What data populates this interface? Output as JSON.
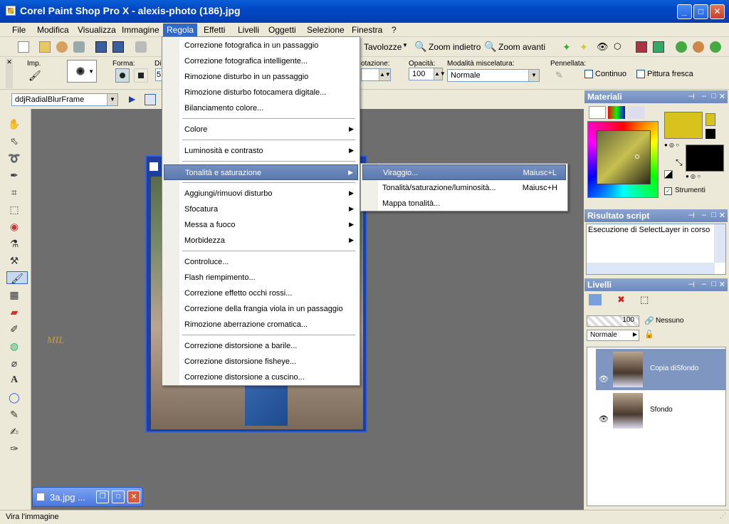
{
  "window": {
    "title": "Corel Paint Shop Pro X - alexis-photo (186).jpg"
  },
  "menubar": [
    "File",
    "Modifica",
    "Visualizza",
    "Immagine",
    "Regola",
    "Effetti",
    "Livelli",
    "Oggetti",
    "Selezione",
    "Finestra",
    "?"
  ],
  "toolbar": {
    "tavolozze": "Tavolozze",
    "zoom_out": "Zoom indietro",
    "zoom_in": "Zoom avanti"
  },
  "options": {
    "imp": "Imp.",
    "forma": "Forma:",
    "di": "Di",
    "rotazione": "otazione:",
    "opacita_label": "Opacità:",
    "opacita_value": "100",
    "blend_label": "Modalità miscelatura:",
    "blend_value": "Normale",
    "pennellata": "Pennellata:",
    "continuo": "Continuo",
    "pittura_fresca": "Pittura fresca",
    "size_partial": "5"
  },
  "script": {
    "name": "ddjRadialBlurFrame"
  },
  "regola_menu": {
    "items": [
      {
        "label": "Correzione fotografica in un passaggio"
      },
      {
        "label": "Correzione fotografica intelligente..."
      },
      {
        "label": "Rimozione disturbo in un passaggio"
      },
      {
        "label": "Rimozione disturbo fotocamera digitale..."
      },
      {
        "label": "Bilanciamento colore..."
      },
      {
        "label": "Colore"
      },
      {
        "label": "Luminosità e contrasto"
      },
      {
        "label": "Tonalità e saturazione"
      },
      {
        "label": "Aggiungi/rimuovi disturbo"
      },
      {
        "label": "Sfocatura"
      },
      {
        "label": "Messa a fuoco"
      },
      {
        "label": "Morbidezza"
      },
      {
        "label": "Controluce..."
      },
      {
        "label": "Flash riempimento..."
      },
      {
        "label": "Correzione effetto occhi rossi..."
      },
      {
        "label": "Correzione della frangia viola in un passaggio"
      },
      {
        "label": "Rimozione aberrazione cromatica..."
      },
      {
        "label": "Correzione distorsione a barile..."
      },
      {
        "label": "Correzione distorsione fisheye..."
      },
      {
        "label": "Correzione distorsione a cuscino..."
      }
    ]
  },
  "submenu": {
    "items": [
      {
        "label": "Viraggio...",
        "shortcut": "Maiusc+L"
      },
      {
        "label": "Tonalità/saturazione/luminosità...",
        "shortcut": "Maiusc+H"
      },
      {
        "label": "Mappa tonalità...",
        "shortcut": ""
      }
    ]
  },
  "materials": {
    "title": "Materiali",
    "strumenti": "Strumenti",
    "fg_color": "#d8c21e",
    "bg_color": "#000000"
  },
  "script_output": {
    "title": "Risultato script",
    "text": "Esecuzione di SelectLayer in corso"
  },
  "layers": {
    "title": "Livelli",
    "opacity": "100",
    "nessuno": "Nessuno",
    "blend": "Normale",
    "items": [
      {
        "name": "Copia diSfondo"
      },
      {
        "name": "Sfondo"
      }
    ]
  },
  "minitab": {
    "label": "3a.jpg ..."
  },
  "watermark": "MIL",
  "status": {
    "text": "Vira l'immagine"
  }
}
